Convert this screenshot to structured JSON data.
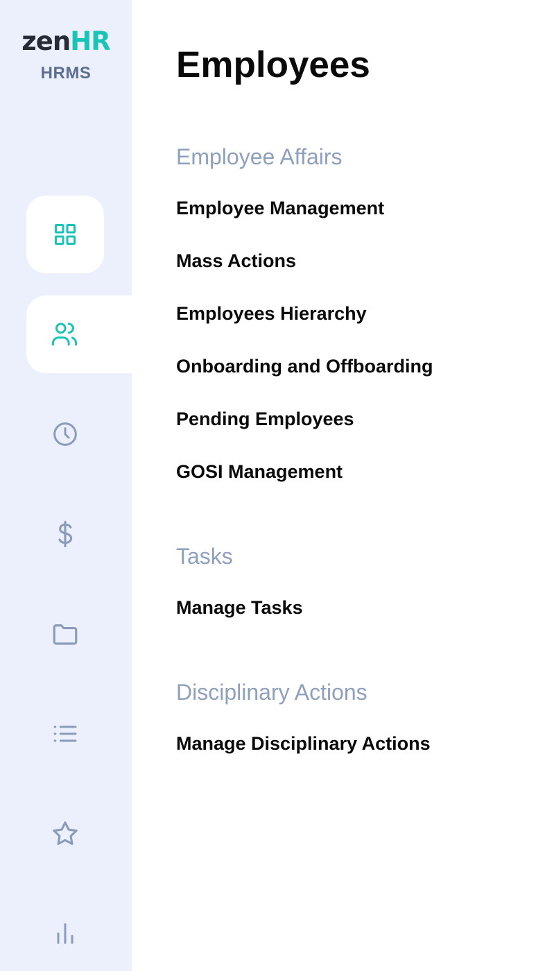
{
  "brand": {
    "logo_zen": "zen",
    "logo_hr": "HR",
    "subtitle": "HRMS",
    "accent_color": "#19c4b7",
    "sidebar_bg": "#ecf0fc"
  },
  "sidebar": {
    "items": [
      {
        "icon": "dashboard-grid-icon",
        "state": "default"
      },
      {
        "icon": "users-icon",
        "state": "active"
      },
      {
        "icon": "clock-icon",
        "state": "default"
      },
      {
        "icon": "dollar-icon",
        "state": "default"
      },
      {
        "icon": "folder-icon",
        "state": "default"
      },
      {
        "icon": "list-icon",
        "state": "default"
      },
      {
        "icon": "star-icon",
        "state": "default"
      },
      {
        "icon": "bar-chart-icon",
        "state": "default"
      }
    ]
  },
  "main": {
    "title": "Employees",
    "sections": [
      {
        "title": "Employee Affairs",
        "links": [
          "Employee Management",
          "Mass Actions",
          "Employees Hierarchy",
          "Onboarding and Offboarding",
          "Pending Employees",
          "GOSI Management"
        ]
      },
      {
        "title": "Tasks",
        "links": [
          "Manage Tasks"
        ]
      },
      {
        "title": "Disciplinary Actions",
        "links": [
          "Manage Disciplinary Actions"
        ]
      }
    ]
  }
}
